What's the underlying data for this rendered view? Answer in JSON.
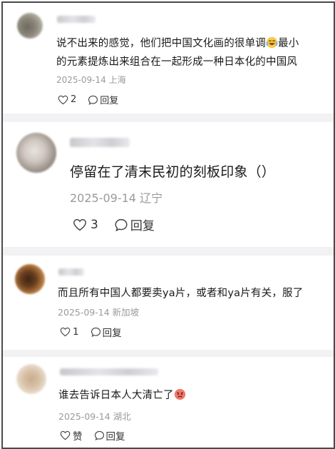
{
  "comments": [
    {
      "text_line1": "说不出来的感觉，他们把中国文化画的很单调",
      "text_line1_tail": "最小",
      "text_line2": "的元素提炼出来组合在一起形成一种日本化的中国风",
      "date": "2025-09-14",
      "location": "上海",
      "like_count": "2",
      "reply_label": "回复",
      "emoji": "crying-laughing-face"
    },
    {
      "text_line1": "停留在了清末民初的刻板印象（）",
      "date": "2025-09-14",
      "location": "辽宁",
      "like_count": "3",
      "reply_label": "回复"
    },
    {
      "text_line1": "而且所有中国人都要卖ya片，或者和ya片有关，服了",
      "date": "2025-09-14",
      "location": "新加坡",
      "like_count": "1",
      "reply_label": "回复"
    },
    {
      "text_line1": "谁去告诉日本人大清亡了",
      "date": "2025-09-14",
      "location": "湖北",
      "like_label": "赞",
      "reply_label": "回复",
      "emoji": "angry-face"
    }
  ],
  "colors": {
    "text": "#1a1a1a",
    "meta": "#9a9a9a",
    "separator": "#f2f2f4",
    "frame_border": "#4a4a4a"
  }
}
